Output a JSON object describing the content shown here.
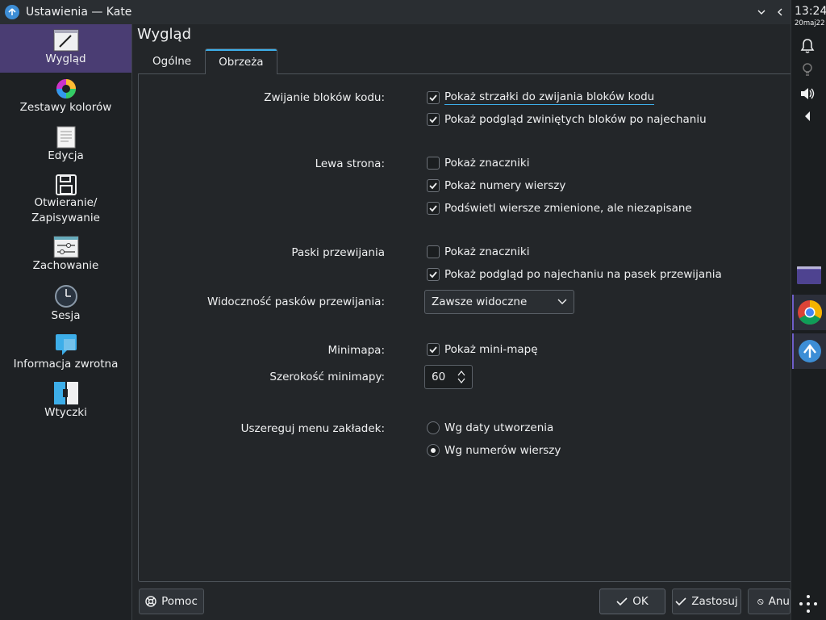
{
  "window": {
    "title": "Ustawienia — Kate"
  },
  "sidebar": {
    "items": [
      {
        "label": "Wygląd"
      },
      {
        "label": "Zestawy kolorów"
      },
      {
        "label": "Edycja"
      },
      {
        "label": "Otwieranie/",
        "label2": "Zapisywanie"
      },
      {
        "label": "Zachowanie"
      },
      {
        "label": "Sesja"
      },
      {
        "label": "Informacja zwrotna"
      },
      {
        "label": "Wtyczki"
      }
    ]
  },
  "page": {
    "title": "Wygląd",
    "tabs": [
      {
        "label": "Ogólne"
      },
      {
        "label": "Obrzeża"
      }
    ]
  },
  "settings": {
    "folding": {
      "label": "Zwijanie bloków kodu:",
      "opt1": "Pokaż strzałki do zwijania bloków kodu",
      "opt2": "Pokaż podgląd zwiniętych bloków po najechaniu"
    },
    "left": {
      "label": "Lewa strona:",
      "opt1": "Pokaż znaczniki",
      "opt2": "Pokaż numery wierszy",
      "opt3": "Podświetl wiersze zmienione, ale niezapisane"
    },
    "scrollbars": {
      "label": "Paski przewijania",
      "opt1": "Pokaż znaczniki",
      "opt2": "Pokaż podgląd po najechaniu na pasek przewijania"
    },
    "visibility": {
      "label": "Widoczność pasków przewijania:",
      "value": "Zawsze widoczne"
    },
    "minimap": {
      "label": "Minimapa:",
      "opt1": "Pokaż mini-mapę"
    },
    "minimap_width": {
      "label": "Szerokość minimapy:",
      "value": "60"
    },
    "sort": {
      "label": "Uszereguj menu zakładek:",
      "opt1": "Wg daty utworzenia",
      "opt2": "Wg numerów wierszy"
    }
  },
  "buttons": {
    "help": "Pomoc",
    "ok": "OK",
    "apply": "Zastosuj",
    "cancel": "Anu"
  },
  "tray": {
    "time": "13:24",
    "date": "20maj22"
  }
}
